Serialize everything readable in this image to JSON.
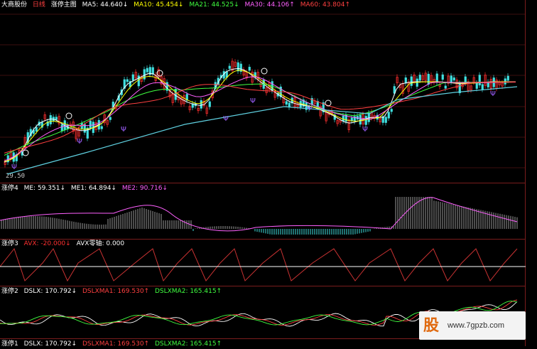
{
  "main": {
    "stock_name": "大商股份",
    "period": "日线",
    "indicator": "涨停主图",
    "ma5": "MA5: 44.640↓",
    "ma10": "MA10: 45.454↓",
    "ma21": "MA21: 44.525↓",
    "ma30": "MA30: 44.106↑",
    "ma60": "MA60: 43.804↑",
    "low_price": "29.50"
  },
  "sub1": {
    "name": "涨停4",
    "me": "ME: 59.351↓",
    "me1": "ME1: 64.894↓",
    "me2": "ME2: 90.716↓"
  },
  "sub2": {
    "name": "涨停3",
    "avx": "AVX: -20.000↓",
    "zero": "AVX零轴: 0.000"
  },
  "sub3": {
    "name": "涨停2",
    "dslx": "DSLX: 170.792↓",
    "ma1": "DSLXMA1: 169.530↑",
    "ma2": "DSLXMA2: 165.415↑"
  },
  "sub4": {
    "name": "涨停1",
    "dslx": "DSLX: 170.792↓",
    "ma1": "DSLXMA1: 169.530↑",
    "ma2": "DSLXMA2: 165.415↑"
  },
  "psi_symbol": "Ψ",
  "watermark": {
    "logo": "股",
    "url": "www.7gpzb.com"
  },
  "colors": {
    "background": "#000000",
    "grid": "#7a1d1d",
    "up": "#ff3030",
    "down": "#40e0e0",
    "ma5": "#ffffff",
    "ma10": "#ffff00",
    "ma21": "#ff60ff",
    "ma30": "#40ff40",
    "ma60": "#ff4040"
  }
}
